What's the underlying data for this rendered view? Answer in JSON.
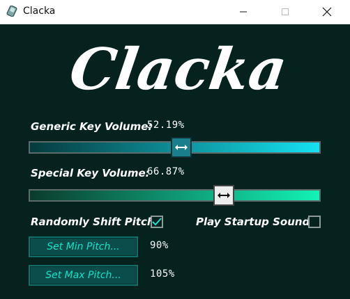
{
  "window": {
    "title": "Clacka",
    "icon": "keycap-icon",
    "controls": [
      "minimize-icon",
      "maximize-icon",
      "close-icon"
    ]
  },
  "logo": {
    "text": "Clacka"
  },
  "generic": {
    "label": "Generic Key Volume:",
    "value_text": "52.19%",
    "value": 0.5219,
    "colors": {
      "from": "#063a3d",
      "to": "#15e2f2"
    }
  },
  "special": {
    "label": "Special Key Volume:",
    "value_text": "66.87%",
    "value": 0.6687,
    "colors": {
      "from": "#0b3b2c",
      "to": "#13f2b6"
    }
  },
  "options": {
    "random_pitch_label": "Randomly Shift Pitch:",
    "random_pitch_checked": true,
    "startup_sound_label": "Play Startup Sound:",
    "startup_sound_checked": false
  },
  "pitch": {
    "min_button": "Set Min Pitch...",
    "min_value": "90%",
    "max_button": "Set Max Pitch...",
    "max_value": "105%"
  }
}
